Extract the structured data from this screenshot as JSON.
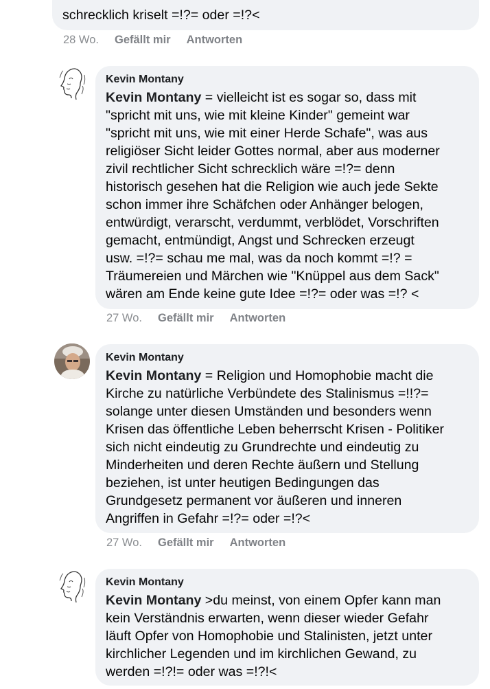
{
  "comments": [
    {
      "text": "schrecklich kriselt =!?= oder =!?<",
      "time": "28 Wo.",
      "like": "Gefällt mir",
      "reply": "Antworten"
    },
    {
      "author": "Kevin Montany",
      "mention": "Kevin Montany",
      "text": " = vielleicht ist es sogar so, dass mit\n\"spricht mit uns, wie mit kleine Kinder\" gemeint war\n\"spricht mit uns, wie mit einer Herde Schafe\", was aus\nreligiöser Sicht leider Gottes normal, aber aus moderner\nzivil rechtlicher Sicht schrecklich wäre =!?= denn\nhistorisch gesehen hat die Religion wie  auch jede Sekte\nschon immer ihre Schäfchen oder Anhänger belogen,\nentwürdigt, verarscht, verdummt, verblödet, Vorschriften\ngemacht, entmündigt, Angst und Schrecken erzeugt\nusw. =!?= schau me mal, was da noch kommt =!? =\nTräumereien und Märchen wie \"Knüppel aus dem Sack\"\nwären am Ende keine gute Idee =!?= oder was =!? <",
      "time": "27 Wo.",
      "like": "Gefällt mir",
      "reply": "Antworten",
      "avatar": "sketch-face-avatar"
    },
    {
      "author": "Kevin Montany",
      "mention": "Kevin Montany",
      "text": " = Religion und Homophobie macht die\nKirche zu natürliche Verbündete des Stalinismus =!!?=\nsolange unter diesen Umständen und besonders wenn\nKrisen das öffentliche Leben beherrscht Krisen - Politiker\nsich  nicht eindeutig zu Grundrechte und eindeutig zu\nMinderheiten und deren Rechte äußern und Stellung\nbeziehen, ist unter heutigen Bedingungen das\nGrundgesetz permanent vor äußeren und inneren\nAngriffen in Gefahr =!?= oder =!?<",
      "time": "27 Wo.",
      "like": "Gefällt mir",
      "reply": "Antworten",
      "avatar": "photo-avatar"
    },
    {
      "author": "Kevin Montany",
      "mention": "Kevin Montany",
      "text": " >du meinst, von einem Opfer kann man\nkein Verständnis erwarten, wenn dieser wieder Gefahr\nläuft Opfer von Homophobie und Stalinisten, jetzt unter\nkirchlicher Legenden und im kirchlichen Gewand, zu\nwerden =!?!= oder was =!?!<",
      "avatar": "sketch-face-avatar"
    }
  ]
}
